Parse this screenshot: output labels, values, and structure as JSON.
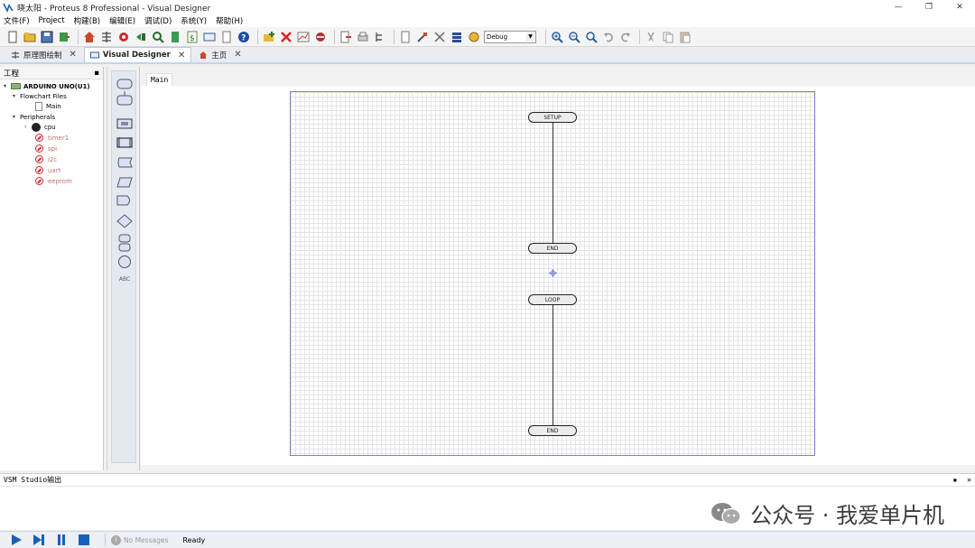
{
  "window": {
    "title": "晓太阳 - Proteus 8 Professional - Visual Designer",
    "controls": [
      "—",
      "❐",
      "✕"
    ]
  },
  "menu": [
    "文件(F)",
    "Project",
    "构建(B)",
    "编辑(E)",
    "调试(D)",
    "系统(Y)",
    "帮助(H)"
  ],
  "toolbar": {
    "debug_combo_value": "Debug"
  },
  "tabs": [
    {
      "label": "原理图绘制",
      "active": false
    },
    {
      "label": "Visual Designer",
      "active": true
    },
    {
      "label": "主页",
      "active": false
    }
  ],
  "project_panel": {
    "title": "工程",
    "pin_icon": "pin-icon",
    "tree": {
      "board": "ARDUINO UNO(U1)",
      "flowchart_files": "Flowchart Files",
      "main_file": "Main",
      "peripherals": "Peripherals",
      "cpu": "cpu",
      "disabled_items": [
        "timer1",
        "spi",
        "i2c",
        "uart",
        "eeprom"
      ]
    }
  },
  "editor": {
    "sheet_tab": "Main",
    "blocks": {
      "setup": "SETUP",
      "end1": "END",
      "loop": "LOOP",
      "end2": "END"
    }
  },
  "palette": {
    "abc_label": "ABC"
  },
  "output_panel": {
    "title": "VSM Studio输出",
    "pin_icon": "pin-icon",
    "close_icon": "close-icon"
  },
  "watermark": {
    "text": "公众号 · 我爱单片机"
  },
  "statusbar": {
    "messages": "No Messages",
    "ready": "Ready"
  },
  "colors": {
    "accent": "#1a5fb4",
    "play_blue": "#1560bd",
    "grid_border": "#7a82c8"
  }
}
